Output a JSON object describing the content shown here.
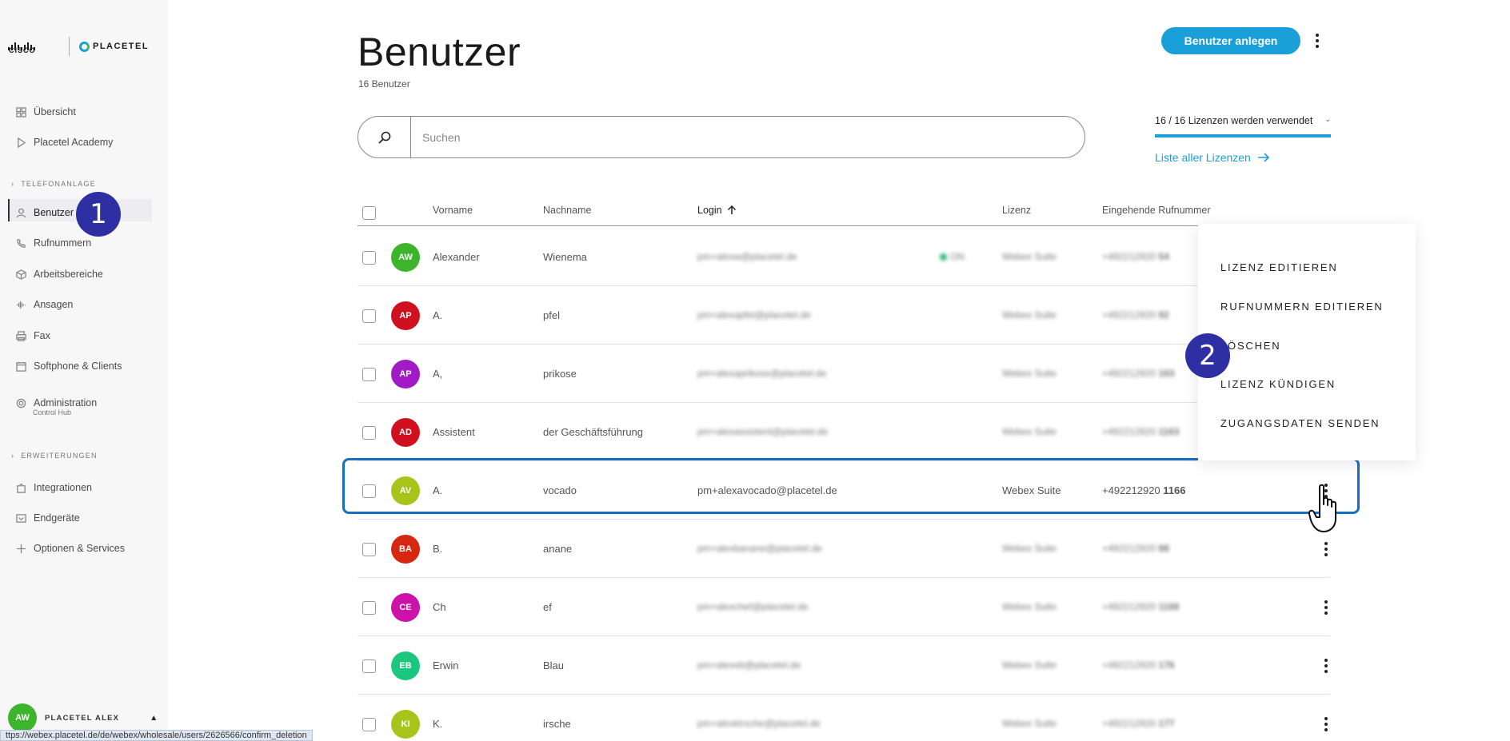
{
  "sidebar": {
    "brand_cisco": "CISCO",
    "brand_placetel": "PLACETEL",
    "items": {
      "overview": "Übersicht",
      "academy": "Placetel Academy",
      "section_telefon": "TELEFONANLAGE",
      "users": "Benutzer",
      "numbers": "Rufnummern",
      "workspaces": "Arbeitsbereiche",
      "announcements": "Ansagen",
      "fax": "Fax",
      "softphone": "Softphone & Clients",
      "admin": "Administration",
      "admin_sub": "Control Hub",
      "section_ext": "ERWEITERUNGEN",
      "integrations": "Integrationen",
      "devices": "Endgeräte",
      "options": "Optionen & Services"
    },
    "account": {
      "initials": "AW",
      "name": "PLACETEL ALEX"
    },
    "status_url": "ttps://webex.placetel.de/de/webex/wholesale/users/2626566/confirm_deletion"
  },
  "step_badges": {
    "one": "1",
    "two": "2"
  },
  "header": {
    "title": "Benutzer",
    "subtitle": "16 Benutzer",
    "create_button": "Benutzer anlegen"
  },
  "search": {
    "placeholder": "Suchen"
  },
  "licenses": {
    "usage": "16 / 16 Lizenzen werden verwendet",
    "link": "Liste aller Lizenzen"
  },
  "table": {
    "columns": {
      "firstname": "Vorname",
      "lastname": "Nachname",
      "login": "Login",
      "license": "Lizenz",
      "incoming": "Eingehende Rufnummer"
    },
    "rows": [
      {
        "initials": "AW",
        "color": "#3cb52c",
        "first": "Alexander",
        "last": "Wienema",
        "login": "pm+alexw@placetel.de",
        "status": "ON",
        "license": "Webex Suite",
        "number": "+492212920",
        "ext": "54"
      },
      {
        "initials": "AP",
        "color": "#d0101e",
        "first": "A.",
        "last": "pfel",
        "login": "pm+alexapfel@placetel.de",
        "status": "",
        "license": "Webex Suite",
        "number": "+492212920",
        "ext": "92"
      },
      {
        "initials": "AP",
        "color": "#a21ac6",
        "first": "A,",
        "last": "prikose",
        "login": "pm+alexaprikose@placetel.de",
        "status": "",
        "license": "Webex Suite",
        "number": "+492212920",
        "ext": "163"
      },
      {
        "initials": "AD",
        "color": "#d0101e",
        "first": "Assistent",
        "last": "der Geschäftsführung",
        "login": "pm+alexassistent@placetel.de",
        "status": "",
        "license": "Webex Suite",
        "number": "+492212920",
        "ext": "1163"
      },
      {
        "initials": "AV",
        "color": "#a6c41a",
        "first": "A.",
        "last": "vocado",
        "login": "pm+alexavocado@placetel.de",
        "status": "",
        "license": "Webex Suite",
        "number": "+492212920",
        "ext": "1166"
      },
      {
        "initials": "BA",
        "color": "#d62710",
        "first": "B.",
        "last": "anane",
        "login": "pm+alexbanane@placetel.de",
        "status": "",
        "license": "Webex Suite",
        "number": "+492212920",
        "ext": "88"
      },
      {
        "initials": "CE",
        "color": "#cc12a8",
        "first": "Ch",
        "last": "ef",
        "login": "pm+alexchef@placetel.de",
        "status": "",
        "license": "Webex Suite",
        "number": "+492212920",
        "ext": "1168"
      },
      {
        "initials": "EB",
        "color": "#1bc77f",
        "first": "Erwin",
        "last": "Blau",
        "login": "pm+alexeb@placetel.de",
        "status": "",
        "license": "Webex Suite",
        "number": "+492212920",
        "ext": "176"
      },
      {
        "initials": "KI",
        "color": "#a6c41a",
        "first": "K.",
        "last": "irsche",
        "login": "pm+alexkirsche@placetel.de",
        "status": "",
        "license": "Webex Suite",
        "number": "+492212920",
        "ext": "177"
      }
    ]
  },
  "context_menu": {
    "edit_license": "LIZENZ EDITIEREN",
    "edit_numbers": "RUFNUMMERN EDITIEREN",
    "delete": "LÖSCHEN",
    "cancel_license": "LIZENZ KÜNDIGEN",
    "send_credentials": "ZUGANGSDATEN SENDEN"
  },
  "colors": {
    "accent": "#1b9fd8",
    "highlight": "#1670c2",
    "badge": "#2d2fa3"
  }
}
